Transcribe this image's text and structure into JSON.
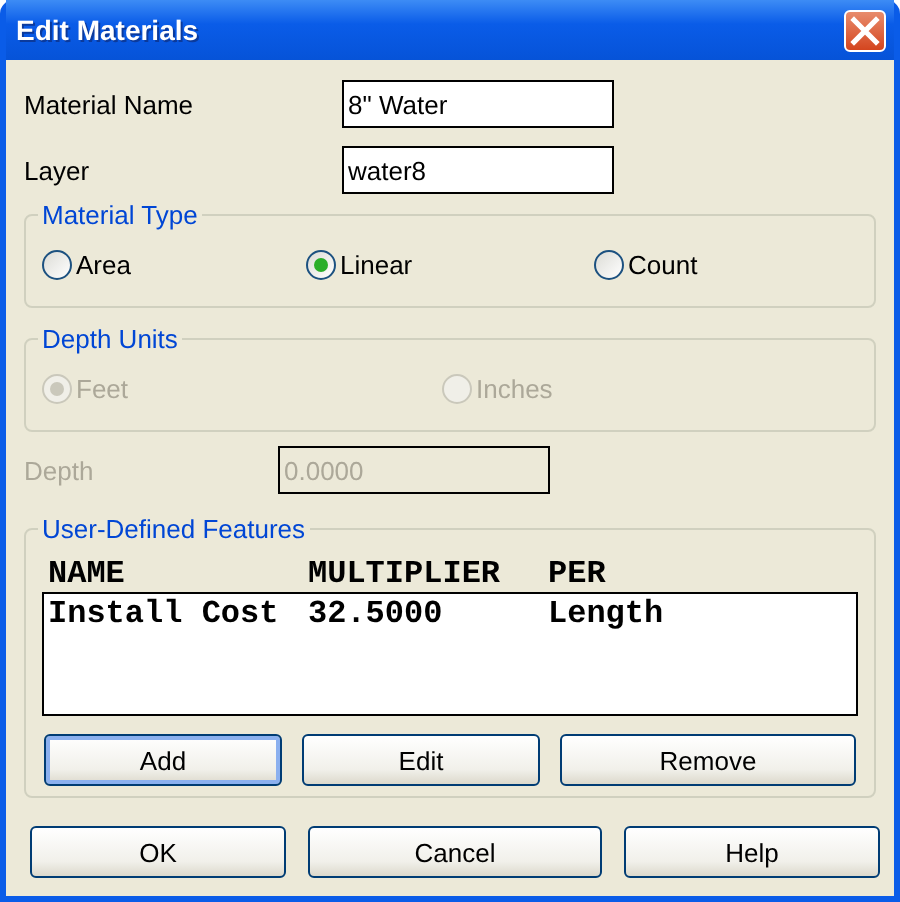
{
  "window": {
    "title": "Edit Materials"
  },
  "fields": [
    {
      "label": "Material Name",
      "value": "8\" Water"
    },
    {
      "label": "Layer",
      "value": "water8"
    }
  ],
  "material_type": {
    "legend": "Material Type",
    "disabled": false,
    "options": [
      {
        "label": "Area",
        "selected": false
      },
      {
        "label": "Linear",
        "selected": true
      },
      {
        "label": "Count",
        "selected": false
      }
    ]
  },
  "depth_units": {
    "legend": "Depth Units",
    "disabled": true,
    "options": [
      {
        "label": "Feet",
        "selected": true
      },
      {
        "label": "Inches",
        "selected": false
      }
    ]
  },
  "depth": {
    "label": "Depth",
    "value": "0.0000",
    "disabled": true
  },
  "features": {
    "legend": "User-Defined Features",
    "columns": [
      "NAME",
      "MULTIPLIER",
      "PER"
    ],
    "rows": [
      [
        "Install Cost",
        "32.5000",
        "Length"
      ]
    ],
    "buttons": [
      {
        "label": "Add",
        "focused": true
      },
      {
        "label": "Edit",
        "focused": false
      },
      {
        "label": "Remove",
        "focused": false
      }
    ]
  },
  "buttons": [
    "OK",
    "Cancel",
    "Help"
  ]
}
